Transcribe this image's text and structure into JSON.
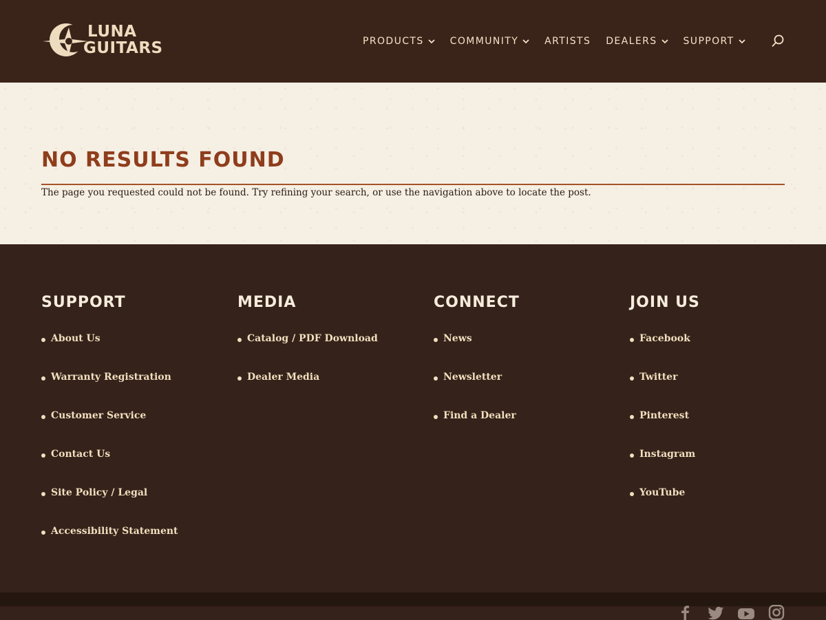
{
  "brand": {
    "line1": "Luna",
    "line2": "Guitars",
    "accent": "#eedcbf"
  },
  "nav": {
    "items": [
      {
        "label": "PRODUCTS",
        "has_dropdown": true
      },
      {
        "label": "COMMUNITY",
        "has_dropdown": true
      },
      {
        "label": "ARTISTS",
        "has_dropdown": false
      },
      {
        "label": "DEALERS",
        "has_dropdown": true
      },
      {
        "label": "SUPPORT",
        "has_dropdown": true
      }
    ],
    "search_icon": "search-icon"
  },
  "main": {
    "title": "No Results Found",
    "message": "The page you requested could not be found. Try refining your search, or use the navigation above to locate the post.",
    "title_color": "#8f3d1c"
  },
  "footer": {
    "columns": [
      {
        "heading": "Support",
        "links": [
          "About Us",
          "Warranty Registration",
          "Customer Service",
          "Contact Us",
          "Site Policy / Legal",
          "Accessibility Statement"
        ]
      },
      {
        "heading": "Media",
        "links": [
          "Catalog / PDF Download",
          "Dealer Media"
        ]
      },
      {
        "heading": "Connect",
        "links": [
          "News",
          "Newsletter",
          "Find a Dealer"
        ]
      },
      {
        "heading": "Join Us",
        "links": [
          "Facebook",
          "Twitter",
          "Pinterest",
          "Instagram",
          "YouTube"
        ]
      }
    ],
    "social_icons": [
      "facebook-icon",
      "twitter-icon",
      "youtube-icon",
      "instagram-icon"
    ]
  },
  "colors": {
    "header_bg": "#3a2318",
    "footer_bg": "#35221a",
    "content_bg": "#f5efe4",
    "link": "#f1dfbf"
  }
}
